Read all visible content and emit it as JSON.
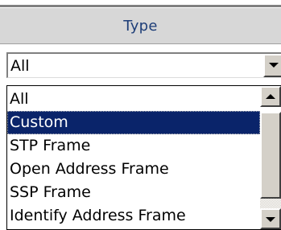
{
  "header": {
    "column_title": "Type"
  },
  "combo": {
    "selected_value": "All"
  },
  "dropdown": {
    "items": [
      {
        "label": "All"
      },
      {
        "label": "Custom"
      },
      {
        "label": "STP Frame"
      },
      {
        "label": "Open Address Frame"
      },
      {
        "label": "SSP Frame"
      },
      {
        "label": "Identify Address Frame"
      }
    ],
    "highlighted_item": "Custom"
  },
  "icons": {
    "combo_arrow": "chevron-down-icon",
    "scroll_up": "scroll-up-arrow-icon",
    "scroll_down": "scroll-down-arrow-icon"
  },
  "colors": {
    "header_text": "#1e3e78",
    "header_bg": "#d7d7d7",
    "selection_bg": "#0a246a",
    "selection_text": "#ffffff",
    "button_face": "#d4d0c8"
  }
}
